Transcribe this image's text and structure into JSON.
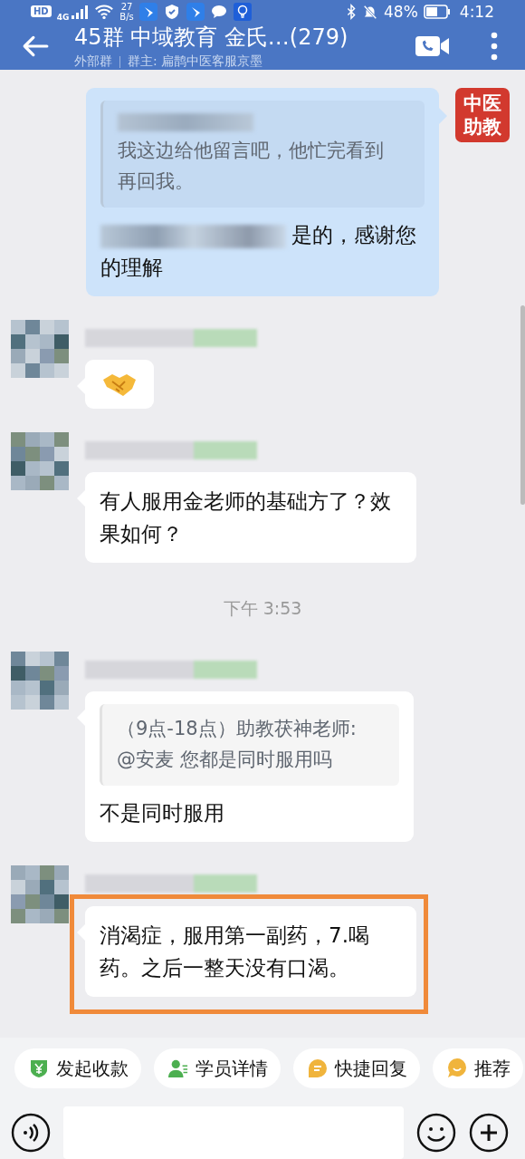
{
  "status_bar": {
    "hd": "HD",
    "network": "4G",
    "speed_value": "27",
    "speed_unit": "B/s",
    "battery": "48%",
    "time": "4:12"
  },
  "header": {
    "title": "45群 中域教育 金氏…(279)",
    "group_type": "外部群",
    "owner": "群主: 扁鹊中医客服京墨"
  },
  "messages": [
    {
      "kind": "sent",
      "avatar_text": "中医助教",
      "quote": {
        "text": "我这边给他留言吧，他忙完看到再回我。"
      },
      "text": "是的，感谢您的理解"
    },
    {
      "kind": "received_emoji",
      "highlighted": false
    },
    {
      "kind": "received",
      "text": "有人服用金老师的基础方了？效果如何？",
      "highlighted": false
    },
    {
      "kind": "time",
      "text": "下午 3:53"
    },
    {
      "kind": "received",
      "quote": {
        "author": "（9点-18点）助教茯神老师:",
        "text": "@安麦  您都是同时服用吗"
      },
      "text": "不是同时服用",
      "highlighted": false
    },
    {
      "kind": "received",
      "text": "消渴症，服用第一副药，7.喝药。之后一整天没有口渴。",
      "highlighted": true
    }
  ],
  "shortcuts": [
    {
      "kind": "payment",
      "label": "发起收款"
    },
    {
      "kind": "student",
      "label": "学员详情"
    },
    {
      "kind": "quick",
      "label": "快捷回复"
    },
    {
      "kind": "recommend",
      "label": "推荐"
    }
  ]
}
